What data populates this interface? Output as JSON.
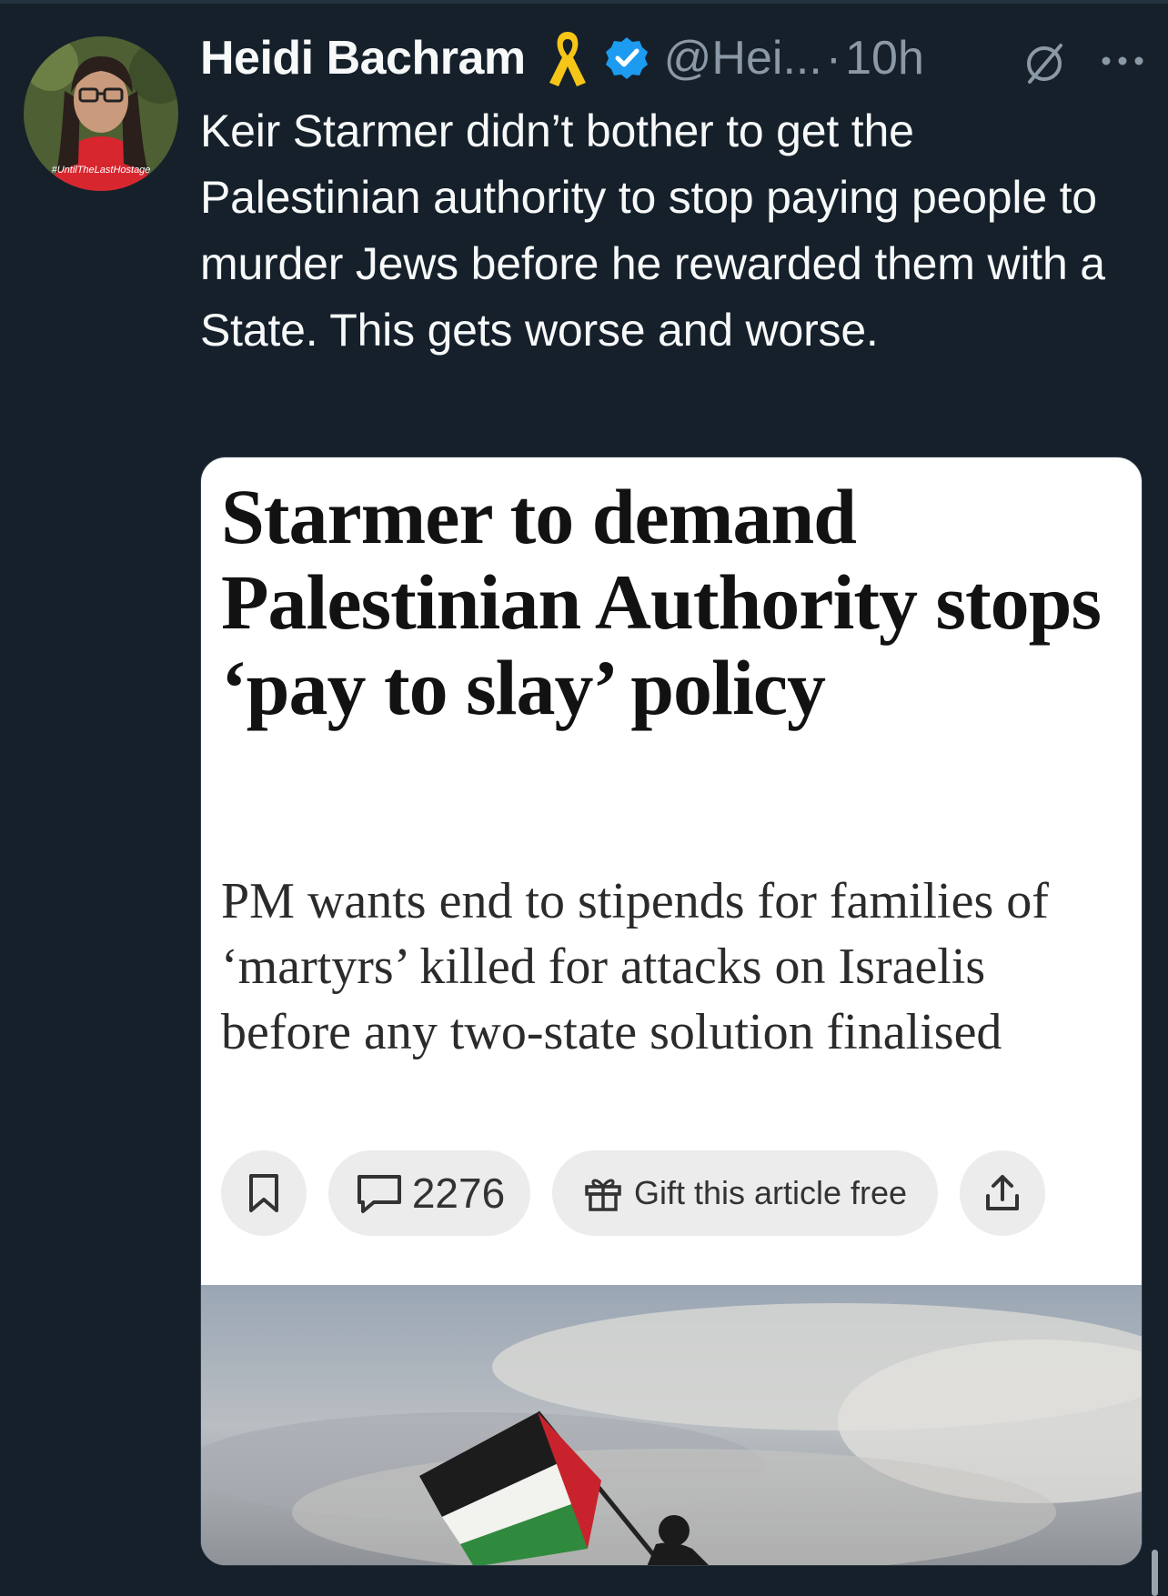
{
  "tweet": {
    "author_name": "Heidi Bachram",
    "handle": "@Hei...",
    "separator": "·",
    "time": "10h",
    "text": "Keir Starmer didn’t bother to get the Palestinian authority to stop paying people to murder Jews before he rewarded them with a State. This gets worse and worse.",
    "avatar_shirt_text": "#UntilTheLastHostage",
    "icons": [
      "yellow-ribbon-icon",
      "verified-badge-icon",
      "grok-icon",
      "more-options-icon"
    ],
    "colors": {
      "background": "#15202b",
      "text": "#f7f9f9",
      "secondary_text": "#8b98a5",
      "verified_blue": "#1d9bf0",
      "ribbon_yellow": "#f5c518"
    }
  },
  "article": {
    "headline": "Starmer to demand Palestinian Authority stops ‘pay to slay’ policy",
    "standfirst": "PM wants end to stipends for families of ‘martyrs’ killed for attacks on Israelis before any two-state solution finalised",
    "comment_count": "2276",
    "gift_label": "Gift this article free",
    "icons": [
      "bookmark-icon",
      "comment-icon",
      "gift-icon",
      "share-icon"
    ]
  }
}
